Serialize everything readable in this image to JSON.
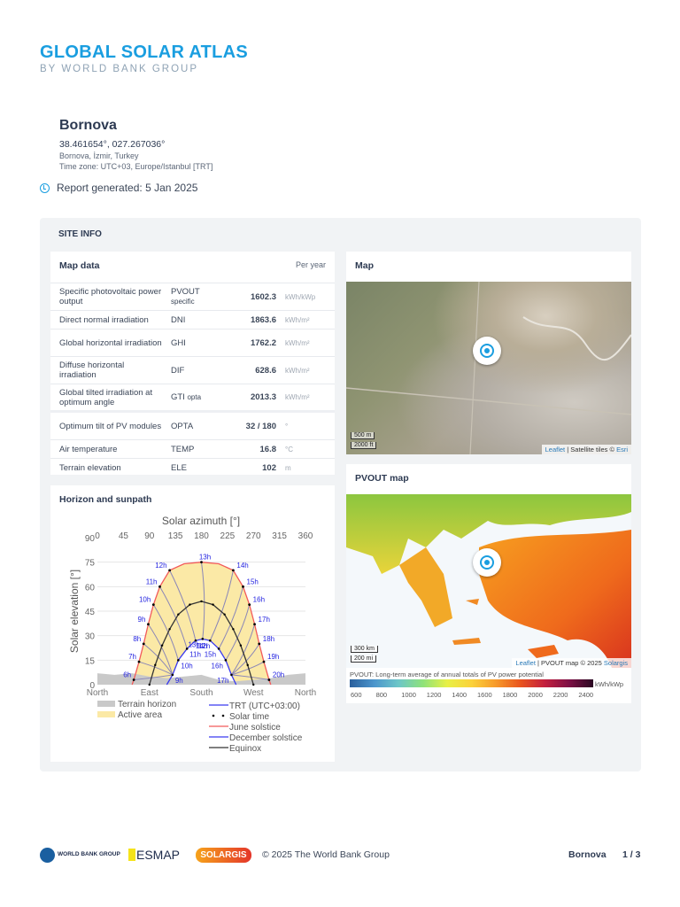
{
  "brand": {
    "title": "GLOBAL SOLAR ATLAS",
    "subtitle": "BY WORLD BANK GROUP"
  },
  "site": {
    "name": "Bornova",
    "coords": "38.461654°, 027.267036°",
    "location": "Bornova, İzmir, Turkey",
    "timezone": "Time zone: UTC+03, Europe/Istanbul [TRT]",
    "report": "Report generated: 5 Jan 2025"
  },
  "site_info": {
    "title": "SITE INFO"
  },
  "map_data": {
    "title": "Map data",
    "period": "Per year",
    "rows": [
      {
        "label": "Specific photovoltaic power output",
        "code": "PVOUT",
        "code_sub": "specific",
        "value": "1602.3",
        "unit": "kWh/kWp"
      },
      {
        "label": "Direct normal irradiation",
        "code": "DNI",
        "code_sub": "",
        "value": "1863.6",
        "unit": "kWh/m²"
      },
      {
        "label": "Global horizontal irradiation",
        "code": "GHI",
        "code_sub": "",
        "value": "1762.2",
        "unit": "kWh/m²"
      },
      {
        "label": "Diffuse horizontal irradiation",
        "code": "DIF",
        "code_sub": "",
        "value": "628.6",
        "unit": "kWh/m²"
      },
      {
        "label": "Global tilted irradiation at optimum angle",
        "code": "GTI",
        "code_sub": "opta",
        "value": "2013.3",
        "unit": "kWh/m²"
      },
      {
        "label": "Optimum tilt of PV modules",
        "code": "OPTA",
        "code_sub": "",
        "value": "32 / 180",
        "unit": "°"
      },
      {
        "label": "Air temperature",
        "code": "TEMP",
        "code_sub": "",
        "value": "16.8",
        "unit": "°C"
      },
      {
        "label": "Terrain elevation",
        "code": "ELE",
        "code_sub": "",
        "value": "102",
        "unit": "m"
      }
    ]
  },
  "map": {
    "title": "Map",
    "scale_m": "500 m",
    "scale_ft": "2000 ft",
    "attr_leaflet": "Leaflet",
    "attr_rest": " | Satellite tiles © ",
    "attr_esri": "Esri"
  },
  "pvout_map": {
    "title": "PVOUT map",
    "scale_km": "300 km",
    "scale_mi": "200 mi",
    "attr_leaflet": "Leaflet",
    "attr_rest": " | PVOUT map © 2025 ",
    "attr_solargis": "Solargis",
    "legend_title": "PVOUT: Long-term average of annual totals of PV power potential",
    "legend_unit": "kWh/kWp",
    "legend_ticks": [
      "600",
      "800",
      "1000",
      "1200",
      "1400",
      "1600",
      "1800",
      "2000",
      "2200",
      "2400"
    ]
  },
  "horizon": {
    "title": "Horizon and sunpath"
  },
  "chart_data": {
    "type": "line",
    "title": "Solar azimuth [°]",
    "ylabel": "Solar elevation [°]",
    "xlim": [
      0,
      360
    ],
    "ylim": [
      0,
      90
    ],
    "xticks": [
      "0",
      "45",
      "90",
      "135",
      "180",
      "225",
      "270",
      "315",
      "360"
    ],
    "yticks": [
      "0",
      "15",
      "30",
      "45",
      "60",
      "75",
      "90"
    ],
    "xlabels_bottom": [
      "North",
      "East",
      "South",
      "West",
      "North"
    ],
    "terrain_horizon": {
      "az": [
        0,
        30,
        60,
        90,
        120,
        150,
        180,
        210,
        240,
        270,
        300,
        330,
        360
      ],
      "el": [
        7,
        6,
        7,
        5,
        4,
        5,
        6,
        3,
        2,
        3,
        4,
        6,
        7
      ]
    },
    "series": [
      {
        "name": "June solstice",
        "color": "#f25a5a",
        "az": [
          60,
          63,
          72,
          80,
          88,
          97,
          108,
          125,
          150,
          180,
          210,
          235,
          252,
          263,
          272,
          280,
          288,
          297,
          300
        ],
        "el": [
          0,
          3,
          14,
          25,
          37,
          49,
          60,
          70,
          74,
          75,
          74,
          70,
          60,
          49,
          37,
          25,
          14,
          3,
          0
        ]
      },
      {
        "name": "December solstice",
        "color": "#3a3af0",
        "az": [
          120,
          130,
          140,
          155,
          170,
          182,
          195,
          210,
          222,
          232,
          240
        ],
        "el": [
          0,
          6,
          15,
          22,
          27,
          28,
          27,
          22,
          15,
          6,
          0
        ]
      },
      {
        "name": "Equinox",
        "color": "#333333",
        "az": [
          90,
          100,
          112,
          125,
          140,
          160,
          180,
          200,
          220,
          235,
          248,
          260,
          270
        ],
        "el": [
          0,
          12,
          24,
          34,
          43,
          49,
          51,
          49,
          43,
          34,
          24,
          12,
          0
        ]
      }
    ],
    "june_hours": [
      "6h",
      "7h",
      "8h",
      "9h",
      "10h",
      "11h",
      "12h",
      "13h",
      "14h",
      "15h",
      "16h",
      "17h",
      "18h",
      "19h",
      "20h"
    ],
    "june_hour_points": [
      [
        63,
        3
      ],
      [
        72,
        14
      ],
      [
        80,
        25
      ],
      [
        88,
        37
      ],
      [
        97,
        49
      ],
      [
        108,
        60
      ],
      [
        125,
        70
      ],
      [
        180,
        75
      ],
      [
        235,
        70
      ],
      [
        252,
        60
      ],
      [
        263,
        49
      ],
      [
        272,
        37
      ],
      [
        280,
        25
      ],
      [
        288,
        14
      ],
      [
        297,
        3
      ]
    ],
    "dec_hours": [
      "9h",
      "10h",
      "11h",
      "12h",
      "13h",
      "14h",
      "15h",
      "16h",
      "17h"
    ],
    "dec_hour_points": [
      [
        130,
        6
      ],
      [
        140,
        15
      ],
      [
        155,
        22
      ],
      [
        170,
        27
      ],
      [
        182,
        28
      ],
      [
        195,
        27
      ],
      [
        210,
        22
      ],
      [
        222,
        15
      ],
      [
        232,
        6
      ]
    ],
    "legend": [
      "Terrain horizon",
      "Active area",
      "TRT (UTC+03:00)",
      "Solar time",
      "June solstice",
      "December solstice",
      "Equinox"
    ]
  },
  "footer": {
    "wbg": "WORLD BANK GROUP",
    "esmap": "ESMAP",
    "solargis": "SOLARGIS",
    "copyright": "© 2025 The World Bank Group",
    "site": "Bornova",
    "page": "1 / 3"
  }
}
